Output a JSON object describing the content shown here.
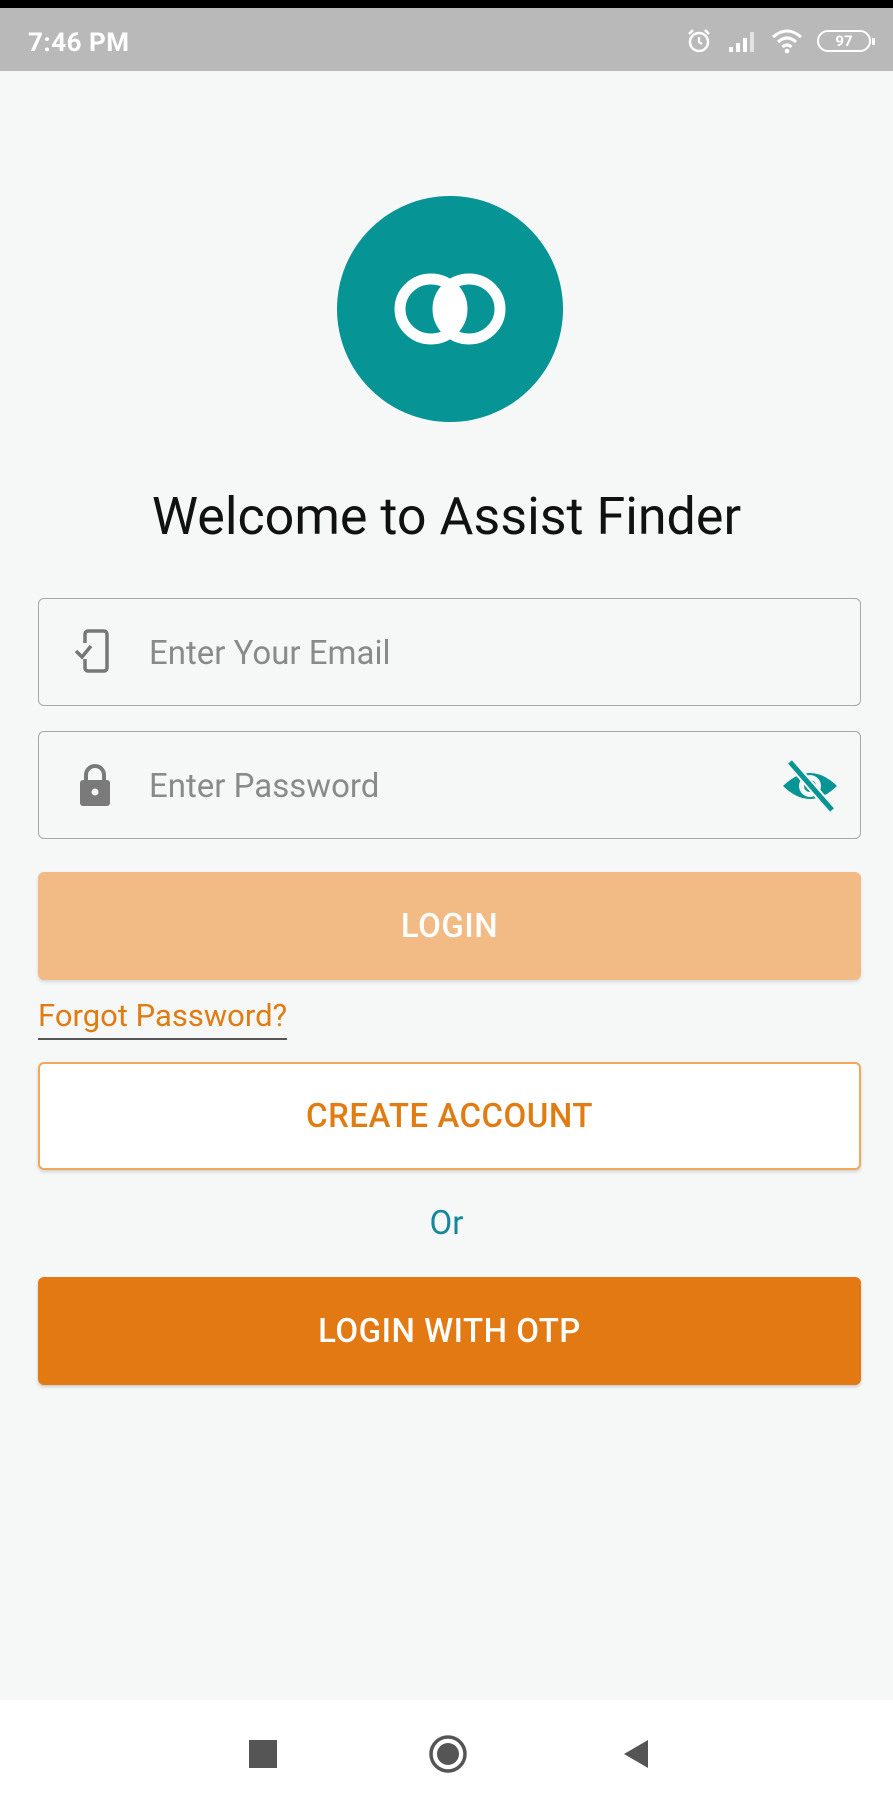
{
  "status_bar": {
    "time": "7:46 PM",
    "battery": "97",
    "icons": [
      "alarm-icon",
      "signal-icon",
      "wifi-icon",
      "battery-icon"
    ]
  },
  "logo": {
    "icon": "app-logo-icon",
    "color": "#069494"
  },
  "welcome_title": "Welcome to Assist Finder",
  "email_field": {
    "placeholder": "Enter Your Email",
    "value": "",
    "icon": "phone-check-icon"
  },
  "password_field": {
    "placeholder": "Enter Password",
    "value": "",
    "icon": "lock-icon",
    "toggle_icon": "eye-off-icon"
  },
  "buttons": {
    "login": "LOGIN",
    "create_account": "CREATE ACCOUNT",
    "login_otp": "LOGIN WITH OTP"
  },
  "forgot_password": "Forgot Password?",
  "or_text": "Or",
  "colors": {
    "accent_orange": "#e37912",
    "login_disabled": "#f2bb86",
    "teal": "#069494"
  },
  "nav_bar": {
    "icons": [
      "recents-icon",
      "home-icon",
      "back-icon"
    ]
  }
}
